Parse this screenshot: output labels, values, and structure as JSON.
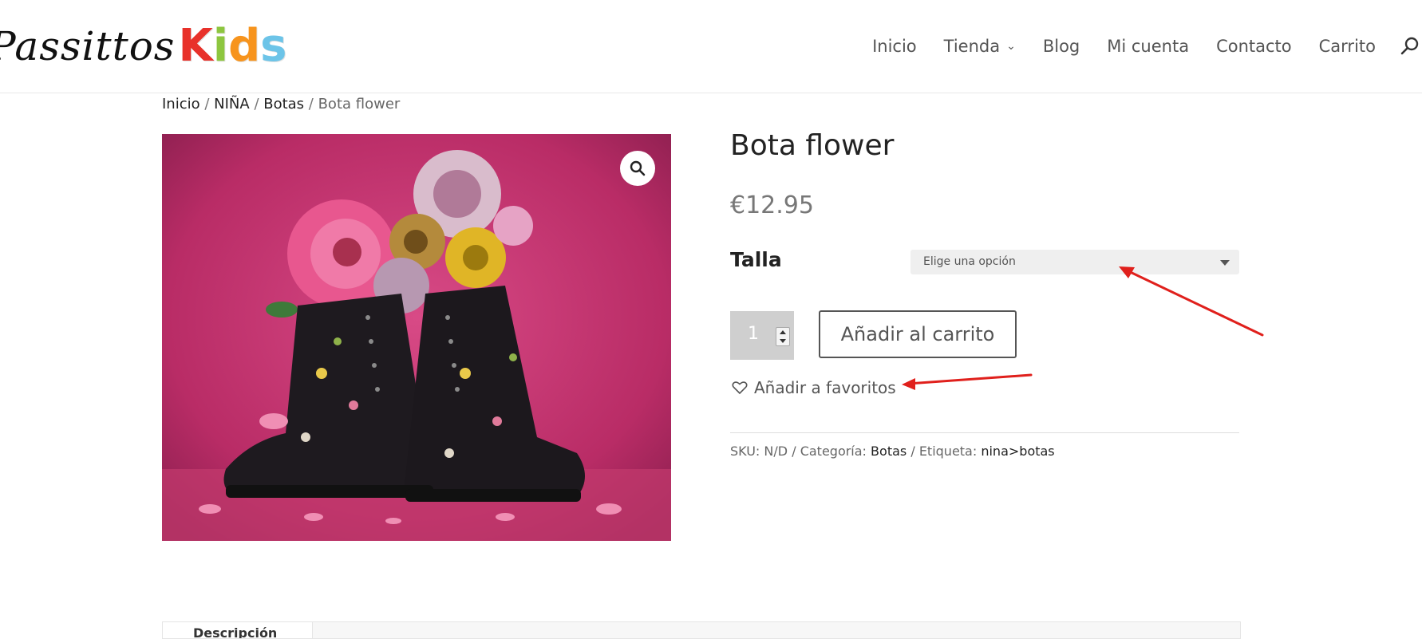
{
  "site": {
    "logo_part1": "Passittos",
    "logo_kids_letters": [
      {
        "char": "K",
        "color": "#e8312a"
      },
      {
        "char": "i",
        "color": "#8dc63f"
      },
      {
        "char": "d",
        "color": "#f7941d"
      },
      {
        "char": "s",
        "color": "#6cc4e8"
      }
    ]
  },
  "nav": {
    "items": [
      {
        "label": "Inicio"
      },
      {
        "label": "Tienda",
        "has_dropdown": true
      },
      {
        "label": "Blog"
      },
      {
        "label": "Mi cuenta"
      },
      {
        "label": "Contacto"
      },
      {
        "label": "Carrito"
      }
    ],
    "search_icon": "search-icon"
  },
  "breadcrumb": {
    "items": [
      "Inicio",
      "NIÑA",
      "Botas"
    ],
    "current": "Bota flower",
    "separator": " / "
  },
  "product": {
    "title": "Bota flower",
    "price": "€12.95",
    "attribute_label": "Talla",
    "select_placeholder": "Elige una opción",
    "quantity": "1",
    "add_to_cart_label": "Añadir al carrito",
    "favorites_label": "Añadir a favoritos",
    "meta": {
      "sku_label": "SKU:",
      "sku_value": "N/D",
      "category_label": "Categoría:",
      "category_value": "Botas",
      "tag_label": "Etiqueta:",
      "tag_value": "nina>botas"
    }
  },
  "tabs": {
    "first_label": "Descripción"
  },
  "colors": {
    "annotation_arrow": "#e0201c",
    "image_background": "#c8336e"
  }
}
